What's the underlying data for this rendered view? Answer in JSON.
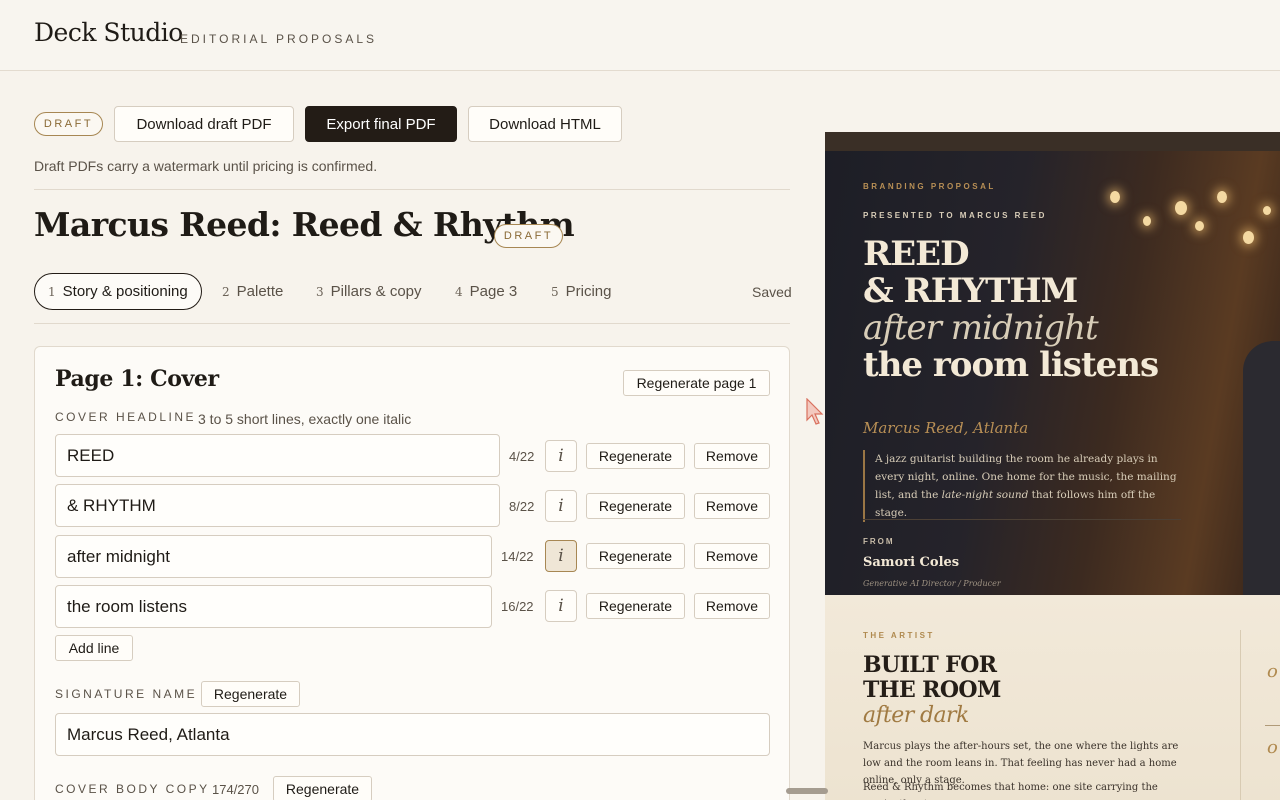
{
  "app": {
    "brand": "Deck Studio",
    "subtitle": "EDITORIAL PROPOSALS"
  },
  "toolbar": {
    "draft_badge": "DRAFT",
    "download_draft": "Download draft PDF",
    "export_final": "Export final PDF",
    "download_html": "Download HTML",
    "note": "Draft PDFs carry a watermark until pricing is confirmed."
  },
  "project": {
    "title": "Marcus Reed: Reed & Rhythm",
    "status_badge": "DRAFT"
  },
  "steps": {
    "items": [
      {
        "num": "1",
        "label": "Story & positioning"
      },
      {
        "num": "2",
        "label": "Palette"
      },
      {
        "num": "3",
        "label": "Pillars & copy"
      },
      {
        "num": "4",
        "label": "Page 3"
      },
      {
        "num": "5",
        "label": "Pricing"
      }
    ],
    "active": 0,
    "save_status": "Saved"
  },
  "editor": {
    "title": "Page 1: Cover",
    "regenerate_page": "Regenerate page 1",
    "headline": {
      "label": "COVER HEADLINE",
      "hint": "3 to 5 short lines, exactly one italic",
      "lines": [
        {
          "text": "REED",
          "count": "4/22",
          "italic": false
        },
        {
          "text": "& RHYTHM",
          "count": "8/22",
          "italic": false
        },
        {
          "text": "after midnight",
          "count": "14/22",
          "italic": true
        },
        {
          "text": "the room listens",
          "count": "16/22",
          "italic": false
        }
      ],
      "italic_glyph": "i",
      "regenerate": "Regenerate",
      "remove": "Remove",
      "add_line": "Add line"
    },
    "signature": {
      "label": "SIGNATURE NAME",
      "regenerate": "Regenerate",
      "value": "Marcus Reed, Atlanta"
    },
    "body_copy": {
      "label": "COVER BODY COPY",
      "count": "174/270",
      "regenerate": "Regenerate"
    }
  },
  "preview": {
    "cover": {
      "kicker": "BRANDING PROPOSAL",
      "presented_to": "PRESENTED TO MARCUS REED",
      "headline": [
        "REED",
        "& RHYTHM",
        "after midnight",
        "the room listens"
      ],
      "signature": "Marcus Reed, Atlanta",
      "body_before": "A jazz guitarist building the room he already plays in every night, online. One home for the music, the mailing list, and the ",
      "body_italic": "late-night sound",
      "body_after": " that follows him off the stage.",
      "from_label": "FROM",
      "from_name": "Samori Coles",
      "from_role": "Generative AI Director / Producer"
    },
    "artist": {
      "kicker": "THE ARTIST",
      "headline": [
        "BUILT FOR",
        "THE ROOM",
        "after dark"
      ],
      "para1": "Marcus plays the after-hours set, the one where the lights are low and the room leans in. That feeling has never had a home online, only a stage.",
      "para2": "Reed & Rhythm becomes that home: one site carrying the music, the story,",
      "side_glyph": "o"
    },
    "colors": {
      "accent": "#b88f55",
      "dark": "#231c16",
      "cream": "#f3e9d6"
    }
  }
}
